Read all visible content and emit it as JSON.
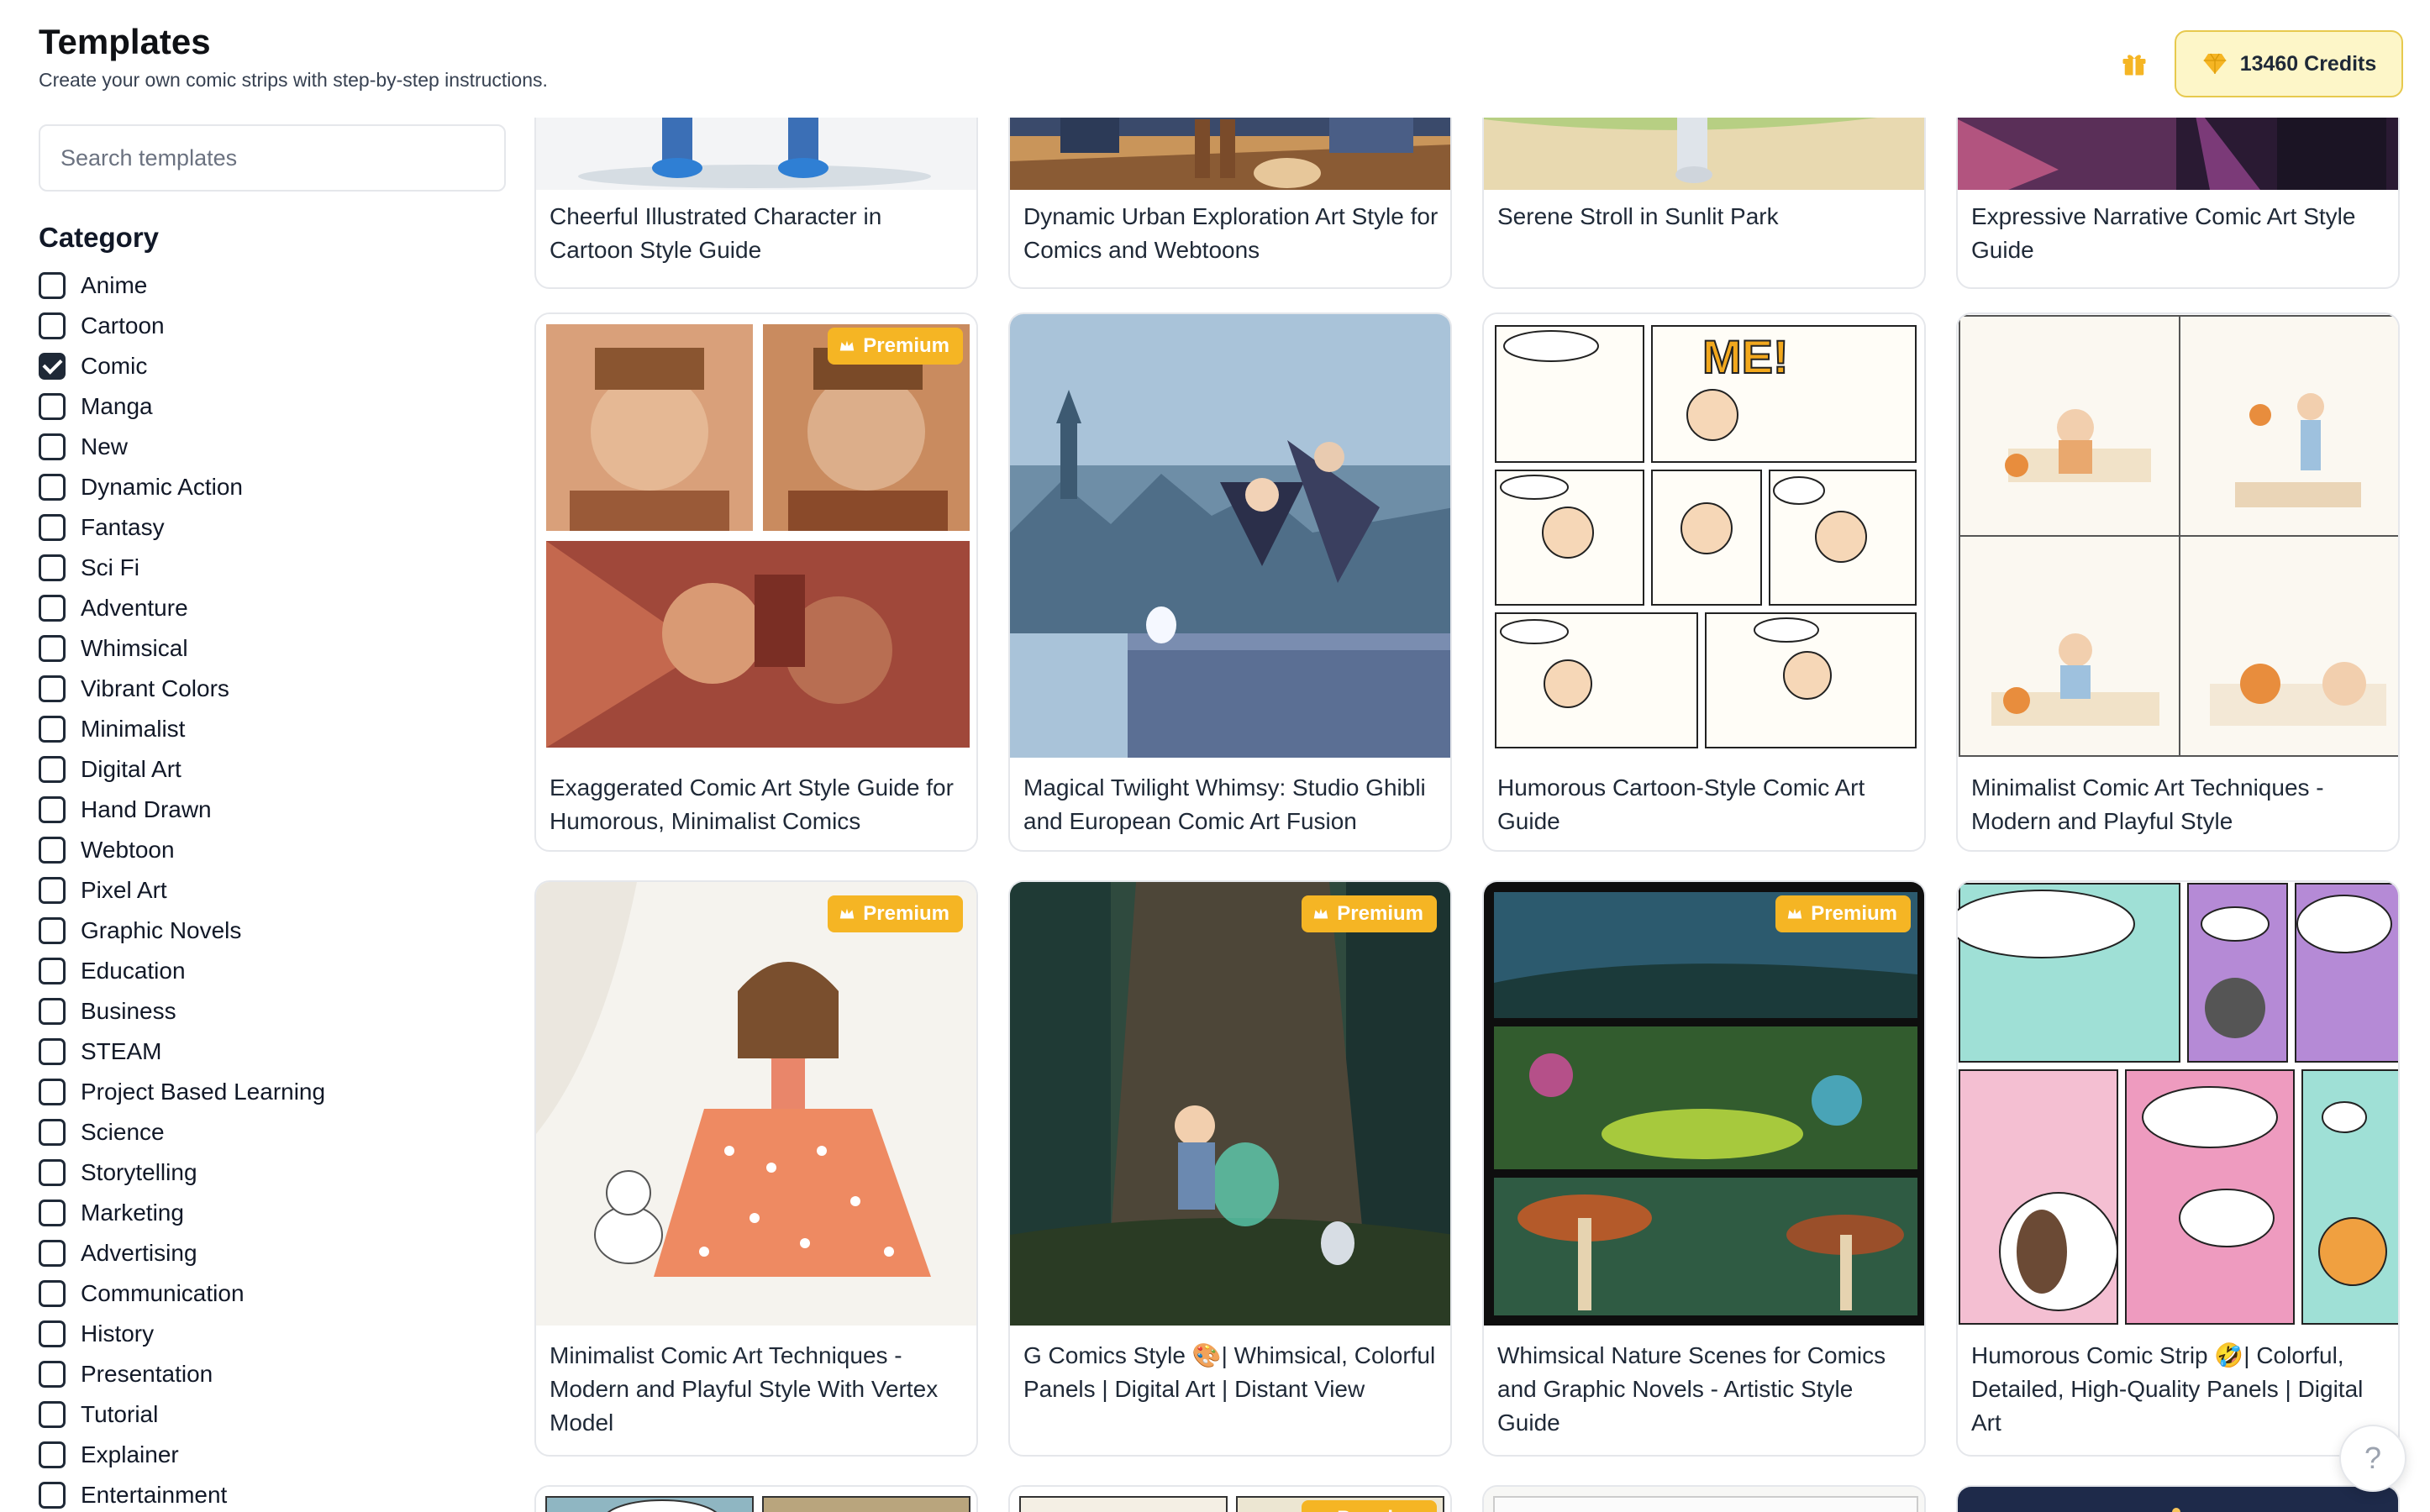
{
  "header": {
    "title": "Templates",
    "subtitle": "Create your own comic strips with step-by-step instructions.",
    "credits_label": "13460 Credits"
  },
  "sidebar": {
    "search_placeholder": "Search templates",
    "category_heading": "Category",
    "categories": [
      {
        "label": "Anime",
        "checked": false
      },
      {
        "label": "Cartoon",
        "checked": false
      },
      {
        "label": "Comic",
        "checked": true
      },
      {
        "label": "Manga",
        "checked": false
      },
      {
        "label": "New",
        "checked": false
      },
      {
        "label": "Dynamic Action",
        "checked": false
      },
      {
        "label": "Fantasy",
        "checked": false
      },
      {
        "label": "Sci Fi",
        "checked": false
      },
      {
        "label": "Adventure",
        "checked": false
      },
      {
        "label": "Whimsical",
        "checked": false
      },
      {
        "label": "Vibrant Colors",
        "checked": false
      },
      {
        "label": "Minimalist",
        "checked": false
      },
      {
        "label": "Digital Art",
        "checked": false
      },
      {
        "label": "Hand Drawn",
        "checked": false
      },
      {
        "label": "Webtoon",
        "checked": false
      },
      {
        "label": "Pixel Art",
        "checked": false
      },
      {
        "label": "Graphic Novels",
        "checked": false
      },
      {
        "label": "Education",
        "checked": false
      },
      {
        "label": "Business",
        "checked": false
      },
      {
        "label": "STEAM",
        "checked": false
      },
      {
        "label": "Project Based Learning",
        "checked": false
      },
      {
        "label": "Science",
        "checked": false
      },
      {
        "label": "Storytelling",
        "checked": false
      },
      {
        "label": "Marketing",
        "checked": false
      },
      {
        "label": "Advertising",
        "checked": false
      },
      {
        "label": "Communication",
        "checked": false
      },
      {
        "label": "History",
        "checked": false
      },
      {
        "label": "Presentation",
        "checked": false
      },
      {
        "label": "Tutorial",
        "checked": false
      },
      {
        "label": "Explainer",
        "checked": false
      },
      {
        "label": "Entertainment",
        "checked": false
      }
    ]
  },
  "premium_label": "Premium",
  "help_label": "?",
  "templates": [
    {
      "title": "Cheerful Illustrated Character in Cartoon Style Guide",
      "premium": false
    },
    {
      "title": "Dynamic Urban Exploration Art Style for Comics and Webtoons",
      "premium": false
    },
    {
      "title": "Serene Stroll in Sunlit Park",
      "premium": false
    },
    {
      "title": "Expressive Narrative Comic Art Style Guide",
      "premium": false
    },
    {
      "title": "Exaggerated Comic Art Style Guide for Humorous, Minimalist Comics",
      "premium": true
    },
    {
      "title": "Magical Twilight Whimsy: Studio Ghibli and European Comic Art Fusion",
      "premium": false
    },
    {
      "title": "Humorous Cartoon-Style Comic Art Guide",
      "premium": false
    },
    {
      "title": "Minimalist Comic Art Techniques - Modern and Playful Style",
      "premium": false
    },
    {
      "title": "Minimalist Comic Art Techniques - Modern and Playful Style With Vertex Model",
      "premium": true
    },
    {
      "title": "G Comics Style 🎨| Whimsical, Colorful Panels | Digital Art | Distant View",
      "premium": true
    },
    {
      "title": "Whimsical Nature Scenes for Comics and Graphic Novels - Artistic Style Guide",
      "premium": true
    },
    {
      "title": "Humorous Comic Strip 🤣| Colorful, Detailed, High-Quality Panels | Digital Art",
      "premium": false
    },
    {
      "title": "",
      "premium": false
    },
    {
      "title": "",
      "premium": true
    },
    {
      "title": "",
      "premium": false
    },
    {
      "title": "",
      "premium": false
    }
  ],
  "colors": {
    "premium": "#f5b524",
    "credits_bg": "#fdf6c8",
    "credits_border": "#e7c94e"
  }
}
